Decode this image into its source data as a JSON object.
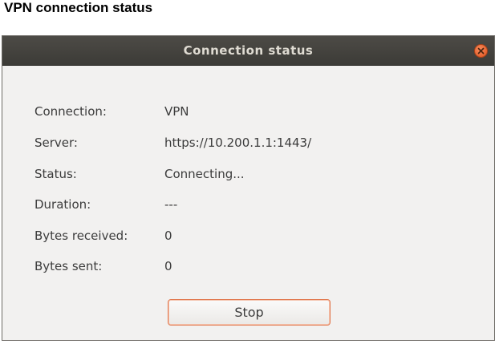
{
  "page": {
    "caption": "VPN connection status"
  },
  "dialog": {
    "title": "Connection status",
    "rows": [
      {
        "label": "Connection:",
        "value": "VPN"
      },
      {
        "label": "Server:",
        "value": "https://10.200.1.1:1443/"
      },
      {
        "label": "Status:",
        "value": "Connecting..."
      },
      {
        "label": "Duration:",
        "value": "---"
      },
      {
        "label": "Bytes received:",
        "value": "0"
      },
      {
        "label": "Bytes sent:",
        "value": "0"
      }
    ],
    "stop_label": "Stop",
    "close_icon": "close-icon"
  },
  "colors": {
    "titlebar": "#3c3b37",
    "window_bg": "#f2f1f0",
    "close_button": "#e0531f",
    "button_border": "#e27b52"
  }
}
